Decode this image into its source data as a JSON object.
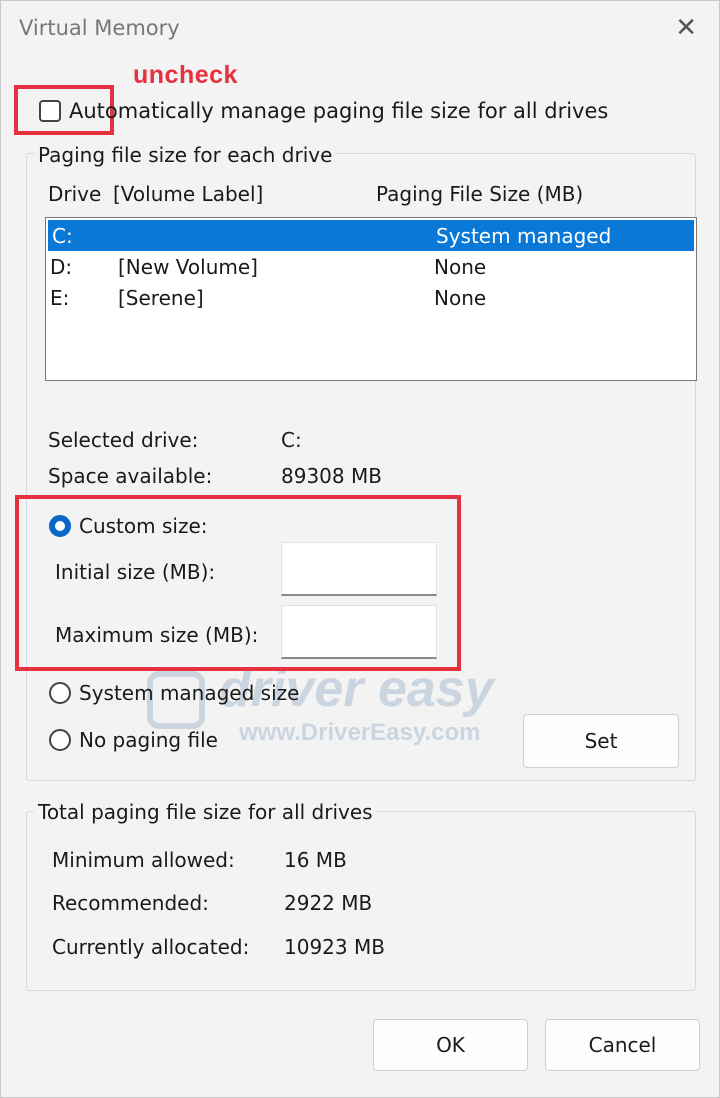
{
  "window": {
    "title": "Virtual Memory",
    "close_glyph": "✕"
  },
  "annotation": {
    "label": "uncheck",
    "color": "#e5323e"
  },
  "auto_manage": {
    "label": "Automatically manage paging file size for all drives",
    "checked": false
  },
  "paging_group": {
    "title": "Paging file size for each drive",
    "columns": {
      "drive": "Drive",
      "volume_label": "[Volume Label]",
      "size": "Paging File Size (MB)"
    },
    "drives": [
      {
        "drive": "C:",
        "label": "",
        "size": "System managed",
        "selected": true
      },
      {
        "drive": "D:",
        "label": "[New Volume]",
        "size": "None",
        "selected": false
      },
      {
        "drive": "E:",
        "label": "[Serene]",
        "size": "None",
        "selected": false
      }
    ],
    "selected_drive_label": "Selected drive:",
    "selected_drive_value": "C:",
    "space_available_label": "Space available:",
    "space_available_value": "89308 MB",
    "custom_size_label": "Custom size:",
    "initial_size_label": "Initial size (MB):",
    "initial_size_value": "",
    "maximum_size_label": "Maximum size (MB):",
    "maximum_size_value": "",
    "system_managed_label": "System managed size",
    "no_paging_label": "No paging file",
    "set_button": "Set",
    "selected_option": "custom"
  },
  "total_group": {
    "title": "Total paging file size for all drives",
    "rows": [
      {
        "label": "Minimum allowed:",
        "value": "16 MB"
      },
      {
        "label": "Recommended:",
        "value": "2922 MB"
      },
      {
        "label": "Currently allocated:",
        "value": "10923 MB"
      }
    ]
  },
  "buttons": {
    "ok": "OK",
    "cancel": "Cancel"
  },
  "watermark": {
    "brand": "driver easy",
    "url": "www.DriverEasy.com"
  },
  "colors": {
    "selection": "#0a78d7",
    "radio_on": "#0a66c7"
  }
}
